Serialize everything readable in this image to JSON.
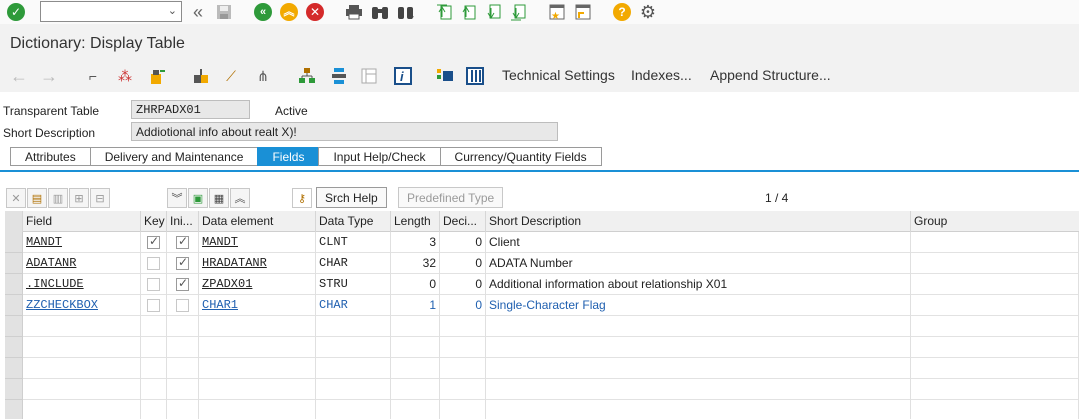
{
  "top_toolbar": {
    "command_field_value": ""
  },
  "title": "Dictionary: Display Table",
  "app_toolbar": {
    "technical_settings": "Technical Settings",
    "indexes": "Indexes...",
    "append_structure": "Append Structure..."
  },
  "header": {
    "table_type_label": "Transparent Table",
    "table_name": "ZHRPADX01",
    "status": "Active",
    "short_desc_label": "Short Description",
    "short_desc_value": "Addiotional info about realt X)!"
  },
  "tabs": [
    {
      "label": "Attributes",
      "active": false
    },
    {
      "label": "Delivery and Maintenance",
      "active": false
    },
    {
      "label": "Fields",
      "active": true
    },
    {
      "label": "Input Help/Check",
      "active": false
    },
    {
      "label": "Currency/Quantity Fields",
      "active": false
    }
  ],
  "table_toolbar": {
    "srch_help": "Srch Help",
    "predefined_type": "Predefined Type",
    "pager": "1 / 4"
  },
  "grid": {
    "columns": [
      "Field",
      "Key",
      "Ini...",
      "Data element",
      "Data Type",
      "Length",
      "Deci...",
      "Short Description",
      "Group"
    ],
    "rows": [
      {
        "field": "MANDT",
        "key": true,
        "initial": true,
        "data_element": "MANDT",
        "data_type": "CLNT",
        "length": "3",
        "decimals": "0",
        "short_description": "Client",
        "group": ""
      },
      {
        "field": "ADATANR",
        "key": false,
        "initial": true,
        "data_element": "HRADATANR",
        "data_type": "CHAR",
        "length": "32",
        "decimals": "0",
        "short_description": "ADATA Number",
        "group": ""
      },
      {
        "field": ".INCLUDE",
        "key": false,
        "initial": true,
        "data_element": "ZPADX01",
        "data_type": "STRU",
        "length": "0",
        "decimals": "0",
        "short_description": "Additional information about relationship X01",
        "group": ""
      },
      {
        "field": "ZZCHECKBOX",
        "key": false,
        "initial": false,
        "data_element": "CHAR1",
        "data_type": "CHAR",
        "length": "1",
        "decimals": "0",
        "short_description": "Single-Character Flag",
        "group": ""
      }
    ]
  },
  "colors": {
    "accent": "#1a90d6",
    "ok_green": "#2e9a3a",
    "cancel_red": "#d42a2a",
    "help_yellow": "#f2a900",
    "link_blue": "#2060b0"
  }
}
